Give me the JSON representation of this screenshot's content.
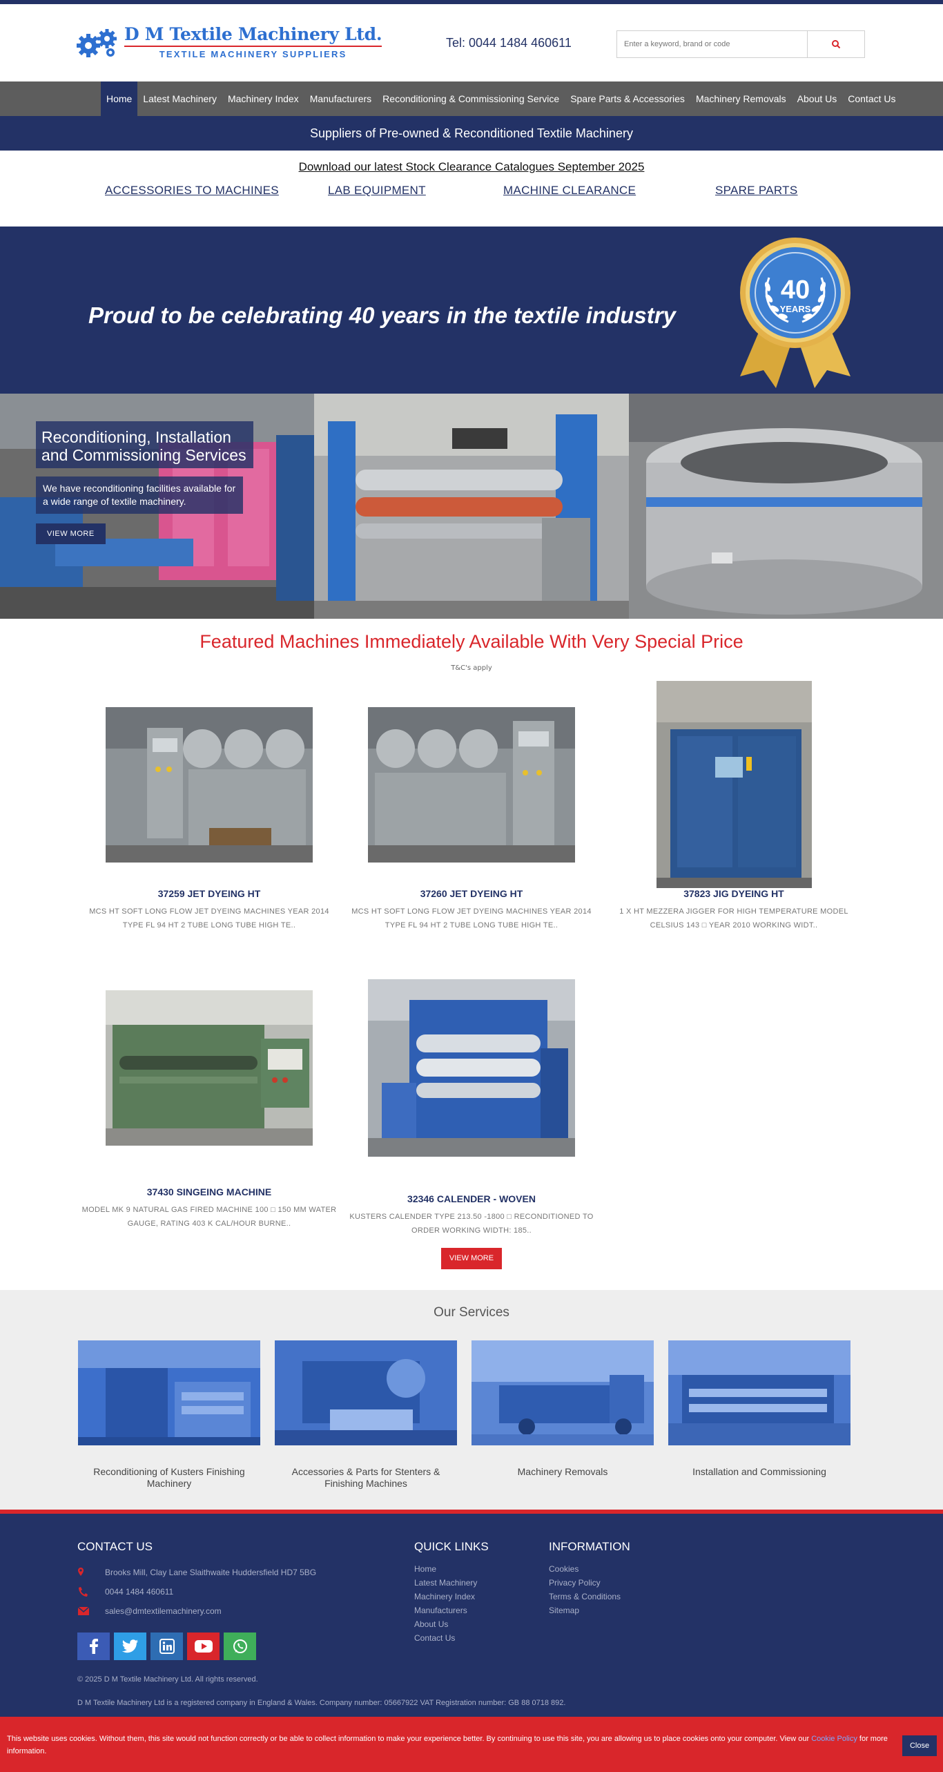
{
  "header": {
    "logo_title": "D M Textile Machinery Ltd.",
    "logo_subtitle": "TEXTILE MACHINERY SUPPLIERS",
    "tel": "Tel: 0044 1484 460611",
    "search_placeholder": "Enter a keyword, brand or code"
  },
  "nav": {
    "items": [
      "Home",
      "Latest Machinery",
      "Machinery Index",
      "Manufacturers",
      "Reconditioning & Commissioning Service",
      "Spare Parts & Accessories",
      "Machinery Removals",
      "About Us",
      "Contact Us"
    ],
    "active": "Home"
  },
  "tagline": "Suppliers of Pre-owned & Reconditioned Textile Machinery",
  "download_link": "Download our latest Stock Clearance Catalogues September 2025",
  "category_links": [
    "ACCESSORIES TO MACHINES",
    "LAB EQUIPMENT",
    "MACHINE CLEARANCE",
    "SPARE PARTS"
  ],
  "banner": {
    "text": "Proud to be celebrating 40 years in the textile industry",
    "medal_number": "40",
    "medal_word": "YEARS"
  },
  "slider": {
    "title": "Reconditioning, Installation and Commissioning Services",
    "text": "We have reconditioning facilities available for a wide range of textile machinery.",
    "button": "VIEW MORE"
  },
  "featured": {
    "title": "Featured Machines Immediately Available With Very Special Price",
    "tc": "T&C's apply",
    "items": [
      {
        "title": "37259 JET DYEING HT",
        "desc": "MCS HT SOFT LONG FLOW JET DYEING MACHINES YEAR 2014 TYPE FL 94 HT 2 TUBE LONG TUBE HIGH TE.."
      },
      {
        "title": "37260 JET DYEING HT",
        "desc": "MCS HT SOFT LONG FLOW JET DYEING MACHINES YEAR 2014 TYPE FL 94 HT 2 TUBE LONG TUBE HIGH TE.."
      },
      {
        "title": "37823 JIG DYEING HT",
        "desc": "1 X HT MEZZERA JIGGER FOR HIGH TEMPERATURE MODEL CELSIUS 143 □ YEAR 2010 WORKING WIDT.."
      },
      {
        "title": "37430 SINGEING MACHINE",
        "desc": "MODEL MK 9 NATURAL GAS FIRED MACHINE 100 □ 150 MM WATER GAUGE, RATING 403 K CAL/HOUR BURNE.."
      },
      {
        "title": "32346 CALENDER - WOVEN",
        "desc": "KUSTERS CALENDER TYPE 213.50 -1800 □ RECONDITIONED TO ORDER WORKING WIDTH: 185.."
      }
    ],
    "view_more": "VIEW MORE"
  },
  "services": {
    "title": "Our Services",
    "items": [
      "Reconditioning of Kusters Finishing Machinery",
      "Accessories & Parts for Stenters & Finishing Machines",
      "Machinery Removals",
      "Installation and Commissioning"
    ]
  },
  "footer": {
    "contact_heading": "CONTACT US",
    "address": "Brooks Mill, Clay Lane Slaithwaite Huddersfield HD7 5BG",
    "phone": "0044 1484 460611",
    "email": "sales@dmtextilemachinery.com",
    "quick_heading": "QUICK LINKS",
    "quick_links": [
      "Home",
      "Latest Machinery",
      "Machinery Index",
      "Manufacturers",
      "About Us",
      "Contact Us"
    ],
    "info_heading": "INFORMATION",
    "info_links": [
      "Cookies",
      "Privacy Policy",
      "Terms & Conditions",
      "Sitemap"
    ],
    "copyright": "© 2025 D M Textile Machinery Ltd. All rights reserved.",
    "registration": "D M Textile Machinery Ltd is a registered company in England & Wales. Company number: 05667922 VAT Registration number: GB 88 0718 892."
  },
  "cookie": {
    "text": "This website uses cookies. Without them, this site would not function correctly or be able to collect information to make your experience better. By continuing to use this site, you are allowing us to place cookies onto your computer. View our",
    "policy_link": "Cookie Policy",
    "text_end": "for more information.",
    "close": "Close"
  },
  "colors": {
    "navy": "#233266",
    "red": "#d9262b",
    "nav_grey": "#5d5d5d",
    "logo_blue": "#2d6fd0"
  }
}
